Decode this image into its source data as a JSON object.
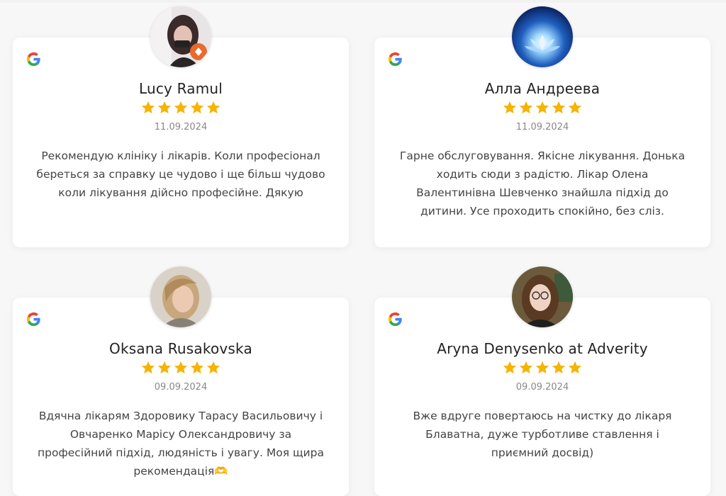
{
  "reviews": [
    {
      "name": "Lucy Ramul",
      "rating": 5,
      "date": "11.09.2024",
      "text": "Рекомендую клініку і лікарів. Коли професіонал береться за справку це чудово і ще більш чудово коли лікування дійсно професійне. Дякую",
      "avatar": "photo-woman-dark-hair"
    },
    {
      "name": "Алла Андреева",
      "rating": 5,
      "date": "11.09.2024",
      "text": "Гарне обслуговування. Якісне лікування. Донька ходить сюди з радістю. Лікар Олена Валентинівна Шевченко знайшла підхід до дитини. Усе проходить спокійно, без сліз.",
      "avatar": "lotus-glow-image"
    },
    {
      "name": "Oksana Rusakovska",
      "rating": 5,
      "date": "09.09.2024",
      "text": "Вдячна лікарям Здоровику Тарасу Васильовичу і Овчаренко Марісу Олександровичу за професійний підхід, людяність і увагу. Моя щира рекомендація🫶",
      "avatar": "photo-woman-light-hair"
    },
    {
      "name": "Aryna Denysenko at Adverity",
      "rating": 5,
      "date": "09.09.2024",
      "text": "Вже вдруге повертаюсь на чистку до лікаря Блаватна, дуже турботливе ставлення і приємний досвід)",
      "avatar": "photo-woman-glasses"
    }
  ],
  "colors": {
    "star": "#f5b400",
    "google_blue": "#4285F4",
    "google_red": "#EA4335",
    "google_yellow": "#FBBC05",
    "google_green": "#34A853"
  },
  "source_icon": "google-g-icon"
}
